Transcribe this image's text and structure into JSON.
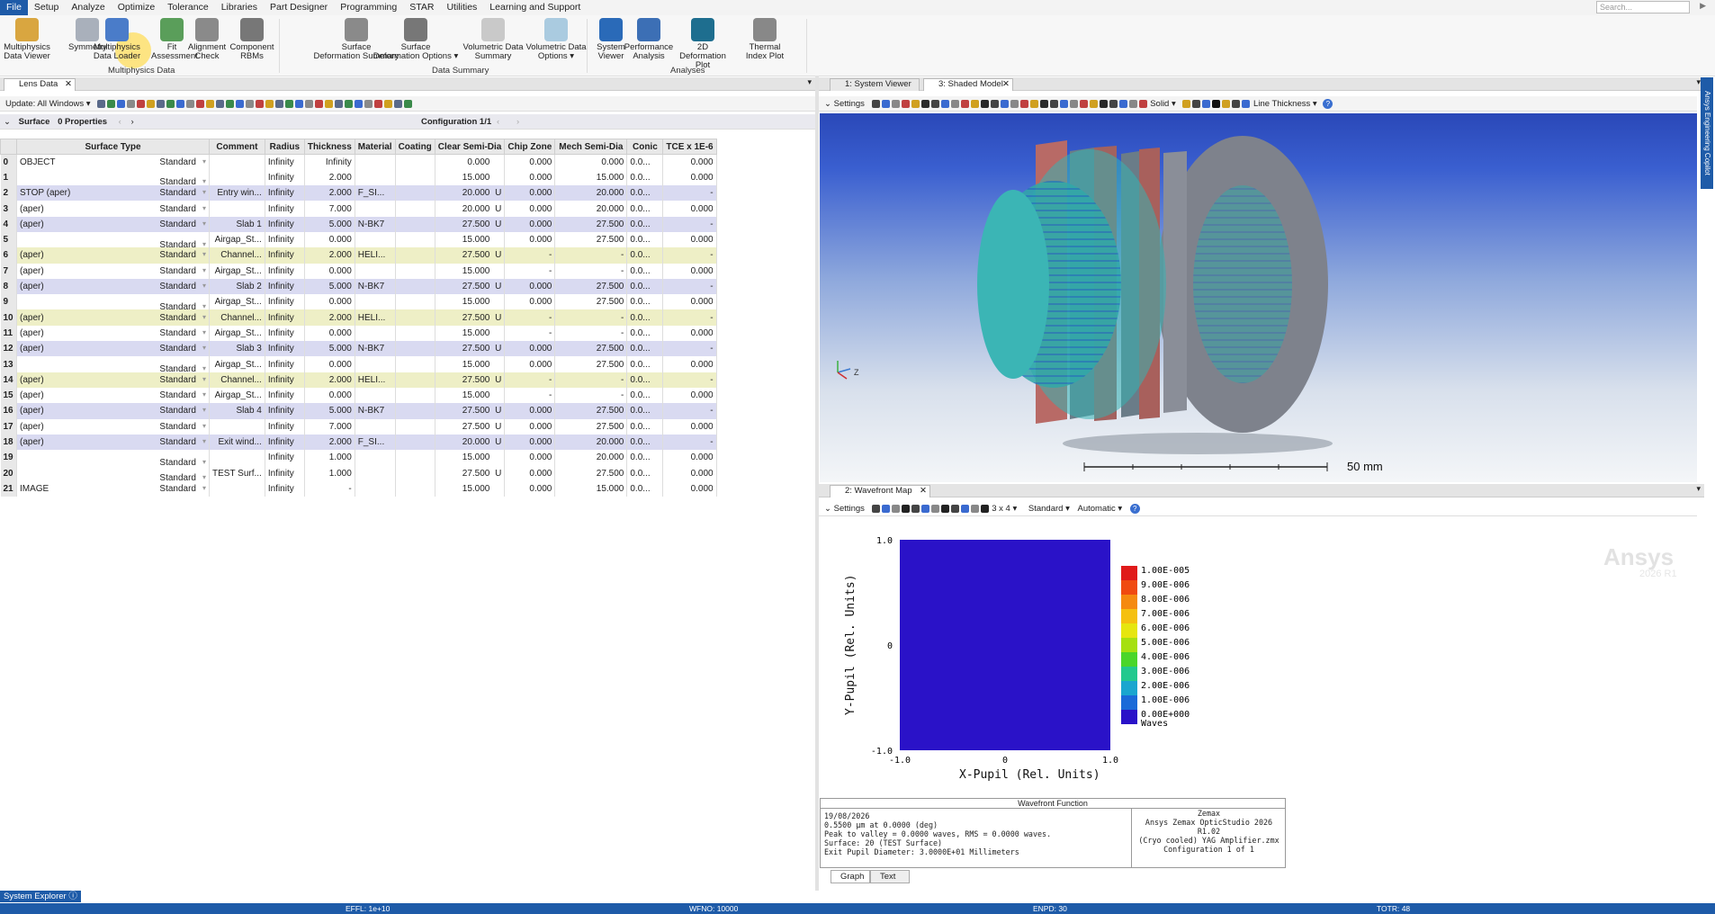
{
  "menu": [
    "File",
    "Setup",
    "Analyze",
    "Optimize",
    "Tolerance",
    "Libraries",
    "Part Designer",
    "Programming",
    "STAR",
    "Utilities",
    "Learning and Support"
  ],
  "search_placeholder": "Search...",
  "ribbon": {
    "buttons": [
      {
        "l1": "Multiphysics",
        "l2": "Data Viewer",
        "icon": "data-viewer-icon",
        "color": "#d9a640"
      },
      {
        "l1": "Symmetry",
        "l2": "",
        "icon": "symmetry-icon",
        "color": "#a9b0bb"
      },
      {
        "l1": "Multiphysics",
        "l2": "Data Loader",
        "icon": "data-loader-icon",
        "color": "#4a7cc9"
      },
      {
        "l1": "Fit",
        "l2": "Assessment",
        "icon": "fit-assessment-icon",
        "color": "#5a9e5a"
      },
      {
        "l1": "Alignment",
        "l2": "Check",
        "icon": "alignment-check-icon",
        "color": "#8a8a8a"
      },
      {
        "l1": "Component",
        "l2": "RBMs",
        "icon": "component-rbms-icon",
        "color": "#777"
      },
      {
        "l1": "Surface",
        "l2": "Deformation Summary",
        "icon": "surface-deformation-icon",
        "color": "#8a8a8a"
      },
      {
        "l1": "Surface",
        "l2": "Deformation Options ▾",
        "icon": "deformation-options-icon",
        "color": "#777"
      },
      {
        "l1": "Volumetric Data",
        "l2": "Summary",
        "icon": "volumetric-summary-icon",
        "color": "#c9c9c9"
      },
      {
        "l1": "Volumetric Data",
        "l2": "Options ▾",
        "icon": "volumetric-options-icon",
        "color": "#aacbe0"
      },
      {
        "l1": "System",
        "l2": "Viewer",
        "icon": "system-viewer-icon",
        "color": "#2a6ab8"
      },
      {
        "l1": "Performance",
        "l2": "Analysis",
        "icon": "performance-analysis-icon",
        "color": "#3c6fb5"
      },
      {
        "l1": "2D",
        "l2": "Deformation Plot",
        "icon": "deformation-plot-2d-icon",
        "color": "#1e6e8f"
      },
      {
        "l1": "Thermal",
        "l2": "Index Plot",
        "icon": "thermal-index-icon",
        "color": "#888"
      }
    ],
    "groups": [
      "Multiphysics Data",
      "Data Summary",
      "Analyses"
    ]
  },
  "lens": {
    "tab": "Lens Data",
    "update": "Update: All Windows ▾",
    "surface_label": "Surface",
    "properties": "0 Properties",
    "configuration": "Configuration 1/1",
    "columns": [
      "",
      "Surface Type",
      "Comment",
      "Radius",
      "Thickness",
      "Material",
      "Coating",
      "Clear Semi-Dia",
      "Chip Zone",
      "Mech Semi-Dia",
      "Conic",
      "TCE x 1E-6"
    ],
    "rows": [
      {
        "n": "0",
        "name": "OBJECT",
        "type": "Standard",
        "comment": "",
        "radius": "Infinity",
        "thick": "Infinity",
        "mat": "",
        "coat": "",
        "clear": "0.000",
        "m1": "",
        "chip": "0.000",
        "mech": "0.000",
        "conic": "0.0...",
        "tce": "0.000",
        "hl": ""
      },
      {
        "n": "1",
        "name": "",
        "type": "Standard",
        "comment": "",
        "radius": "Infinity",
        "thick": "2.000",
        "mat": "",
        "coat": "",
        "clear": "15.000",
        "m1": "",
        "chip": "0.000",
        "mech": "15.000",
        "conic": "0.0...",
        "tce": "0.000",
        "hl": ""
      },
      {
        "n": "2",
        "name": "STOP (aper)",
        "type": "Standard",
        "comment": "Entry win...",
        "radius": "Infinity",
        "thick": "2.000",
        "mat": "F_SI...",
        "coat": "",
        "clear": "20.000",
        "m1": "U",
        "chip": "0.000",
        "mech": "20.000",
        "conic": "0.0...",
        "tce": "-",
        "hl": "purple"
      },
      {
        "n": "3",
        "name": "(aper)",
        "type": "Standard",
        "comment": "",
        "radius": "Infinity",
        "thick": "7.000",
        "mat": "",
        "coat": "",
        "clear": "20.000",
        "m1": "U",
        "chip": "0.000",
        "mech": "20.000",
        "conic": "0.0...",
        "tce": "0.000",
        "hl": ""
      },
      {
        "n": "4",
        "name": "(aper)",
        "type": "Standard",
        "comment": "Slab 1",
        "radius": "Infinity",
        "thick": "5.000",
        "mat": "N-BK7",
        "coat": "",
        "clear": "27.500",
        "m1": "U",
        "chip": "0.000",
        "mech": "27.500",
        "conic": "0.0...",
        "tce": "-",
        "hl": "purple"
      },
      {
        "n": "5",
        "name": "",
        "type": "Standard",
        "comment": "Airgap_St...",
        "radius": "Infinity",
        "thick": "0.000",
        "mat": "",
        "coat": "",
        "clear": "15.000",
        "m1": "",
        "chip": "0.000",
        "mech": "27.500",
        "conic": "0.0...",
        "tce": "0.000",
        "hl": ""
      },
      {
        "n": "6",
        "name": "(aper)",
        "type": "Standard",
        "comment": "Channel...",
        "radius": "Infinity",
        "thick": "2.000",
        "mat": "HELI...",
        "coat": "",
        "clear": "27.500",
        "m1": "U",
        "chip": "-",
        "mech": "-",
        "conic": "0.0...",
        "tce": "-",
        "hl": "yellow"
      },
      {
        "n": "7",
        "name": "(aper)",
        "type": "Standard",
        "comment": "Airgap_St...",
        "radius": "Infinity",
        "thick": "0.000",
        "mat": "",
        "coat": "",
        "clear": "15.000",
        "m1": "",
        "chip": "-",
        "mech": "-",
        "conic": "0.0...",
        "tce": "0.000",
        "hl": ""
      },
      {
        "n": "8",
        "name": "(aper)",
        "type": "Standard",
        "comment": "Slab 2",
        "radius": "Infinity",
        "thick": "5.000",
        "mat": "N-BK7",
        "coat": "",
        "clear": "27.500",
        "m1": "U",
        "chip": "0.000",
        "mech": "27.500",
        "conic": "0.0...",
        "tce": "-",
        "hl": "purple"
      },
      {
        "n": "9",
        "name": "",
        "type": "Standard",
        "comment": "Airgap_St...",
        "radius": "Infinity",
        "thick": "0.000",
        "mat": "",
        "coat": "",
        "clear": "15.000",
        "m1": "",
        "chip": "0.000",
        "mech": "27.500",
        "conic": "0.0...",
        "tce": "0.000",
        "hl": ""
      },
      {
        "n": "10",
        "name": "(aper)",
        "type": "Standard",
        "comment": "Channel...",
        "radius": "Infinity",
        "thick": "2.000",
        "mat": "HELI...",
        "coat": "",
        "clear": "27.500",
        "m1": "U",
        "chip": "-",
        "mech": "-",
        "conic": "0.0...",
        "tce": "-",
        "hl": "yellow"
      },
      {
        "n": "11",
        "name": "(aper)",
        "type": "Standard",
        "comment": "Airgap_St...",
        "radius": "Infinity",
        "thick": "0.000",
        "mat": "",
        "coat": "",
        "clear": "15.000",
        "m1": "",
        "chip": "-",
        "mech": "-",
        "conic": "0.0...",
        "tce": "0.000",
        "hl": ""
      },
      {
        "n": "12",
        "name": "(aper)",
        "type": "Standard",
        "comment": "Slab 3",
        "radius": "Infinity",
        "thick": "5.000",
        "mat": "N-BK7",
        "coat": "",
        "clear": "27.500",
        "m1": "U",
        "chip": "0.000",
        "mech": "27.500",
        "conic": "0.0...",
        "tce": "-",
        "hl": "purple"
      },
      {
        "n": "13",
        "name": "",
        "type": "Standard",
        "comment": "Airgap_St...",
        "radius": "Infinity",
        "thick": "0.000",
        "mat": "",
        "coat": "",
        "clear": "15.000",
        "m1": "",
        "chip": "0.000",
        "mech": "27.500",
        "conic": "0.0...",
        "tce": "0.000",
        "hl": ""
      },
      {
        "n": "14",
        "name": "(aper)",
        "type": "Standard",
        "comment": "Channel...",
        "radius": "Infinity",
        "thick": "2.000",
        "mat": "HELI...",
        "coat": "",
        "clear": "27.500",
        "m1": "U",
        "chip": "-",
        "mech": "-",
        "conic": "0.0...",
        "tce": "-",
        "hl": "yellow"
      },
      {
        "n": "15",
        "name": "(aper)",
        "type": "Standard",
        "comment": "Airgap_St...",
        "radius": "Infinity",
        "thick": "0.000",
        "mat": "",
        "coat": "",
        "clear": "15.000",
        "m1": "",
        "chip": "-",
        "mech": "-",
        "conic": "0.0...",
        "tce": "0.000",
        "hl": ""
      },
      {
        "n": "16",
        "name": "(aper)",
        "type": "Standard",
        "comment": "Slab 4",
        "radius": "Infinity",
        "thick": "5.000",
        "mat": "N-BK7",
        "coat": "",
        "clear": "27.500",
        "m1": "U",
        "chip": "0.000",
        "mech": "27.500",
        "conic": "0.0...",
        "tce": "-",
        "hl": "purple"
      },
      {
        "n": "17",
        "name": "(aper)",
        "type": "Standard",
        "comment": "",
        "radius": "Infinity",
        "thick": "7.000",
        "mat": "",
        "coat": "",
        "clear": "27.500",
        "m1": "U",
        "chip": "0.000",
        "mech": "27.500",
        "conic": "0.0...",
        "tce": "0.000",
        "hl": ""
      },
      {
        "n": "18",
        "name": "(aper)",
        "type": "Standard",
        "comment": "Exit wind...",
        "radius": "Infinity",
        "thick": "2.000",
        "mat": "F_SI...",
        "coat": "",
        "clear": "20.000",
        "m1": "U",
        "chip": "0.000",
        "mech": "20.000",
        "conic": "0.0...",
        "tce": "-",
        "hl": "purple"
      },
      {
        "n": "19",
        "name": "",
        "type": "Standard",
        "comment": "",
        "radius": "Infinity",
        "thick": "1.000",
        "mat": "",
        "coat": "",
        "clear": "15.000",
        "m1": "",
        "chip": "0.000",
        "mech": "20.000",
        "conic": "0.0...",
        "tce": "0.000",
        "hl": ""
      },
      {
        "n": "20",
        "name": "",
        "type": "Standard",
        "comment": "TEST Surf...",
        "radius": "Infinity",
        "thick": "1.000",
        "mat": "",
        "coat": "",
        "clear": "27.500",
        "m1": "U",
        "chip": "0.000",
        "mech": "27.500",
        "conic": "0.0...",
        "tce": "0.000",
        "hl": ""
      },
      {
        "n": "21",
        "name": "IMAGE",
        "type": "Standard",
        "comment": "",
        "radius": "Infinity",
        "thick": "-",
        "mat": "",
        "coat": "",
        "clear": "15.000",
        "m1": "",
        "chip": "0.000",
        "mech": "15.000",
        "conic": "0.0...",
        "tce": "0.000",
        "hl": ""
      }
    ]
  },
  "viewer": {
    "tab1": "1: System Viewer",
    "tab2": "3: Shaded Model",
    "settings": "Settings",
    "solid": "Solid ▾",
    "line_thickness": "Line Thickness ▾",
    "scale": "50 mm",
    "axis_label": "Z"
  },
  "wavefront": {
    "tab": "2: Wavefront Map",
    "settings": "Settings",
    "grid": "3 x 4 ▾",
    "standard": "Standard ▾",
    "automatic": "Automatic ▾",
    "watermark1": "Ansys",
    "watermark2": "2026 R1",
    "xlabel": "X-Pupil (Rel. Units)",
    "ylabel": "Y-Pupil (Rel. Units)",
    "yticks": [
      "1.0",
      "0",
      "-1.0"
    ],
    "xticks": [
      "-1.0",
      "0",
      "1.0"
    ],
    "fill_color": "#2a12c8",
    "legend": [
      "1.00E-005",
      "9.00E-006",
      "8.00E-006",
      "7.00E-006",
      "6.00E-006",
      "5.00E-006",
      "4.00E-006",
      "3.00E-006",
      "2.00E-006",
      "1.00E-006",
      "0.00E+000"
    ],
    "legend_colors": [
      "#e01a1a",
      "#f04a10",
      "#f58a10",
      "#f5c010",
      "#e6e60f",
      "#a6e010",
      "#4ad62a",
      "#22c98e",
      "#1aa6cf",
      "#1a6ad8",
      "#2a12c8"
    ],
    "units": "Waves",
    "box_title": "Wavefront Function",
    "info": [
      "19/08/2026",
      "0.5500 µm at 0.0000 (deg)",
      "Peak to valley = 0.0000 waves, RMS = 0.0000 waves.",
      "Surface: 20 (TEST Surface)",
      "Exit Pupil Diameter: 3.0000E+01 Millimeters"
    ],
    "right_info": [
      "Zemax",
      "Ansys Zemax OpticStudio 2026 R1.02",
      "",
      "(Cryo cooled) YAG Amplifier.zmx",
      "Configuration 1 of 1"
    ],
    "bottom_tabs": [
      "Graph",
      "Text"
    ]
  },
  "side_label": "Ansys Engineering Copilot",
  "system_explorer": "System Explorer",
  "status": {
    "effl": "EFFL: 1e+10",
    "wfno": "WFNO: 10000",
    "enpd": "ENPD: 30",
    "totr": "TOTR: 48"
  }
}
